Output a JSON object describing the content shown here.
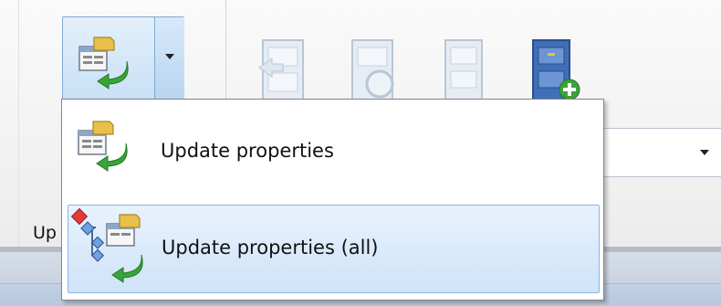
{
  "ribbon": {
    "group_label": "Up",
    "split_button": {
      "icon": "update-properties-icon",
      "arrow_icon": "dropdown-arrow-icon"
    },
    "buttons": [
      {
        "icon": "cabinet-export-icon"
      },
      {
        "icon": "cabinet-search-icon"
      },
      {
        "icon": "cabinet-icon"
      },
      {
        "icon": "cabinet-add-icon"
      }
    ],
    "combo_arrow_icon": "combo-dropdown-icon"
  },
  "menu": {
    "items": [
      {
        "label": "Update properties",
        "icon": "update-properties-icon",
        "highlighted": false
      },
      {
        "label": "Update properties (all)",
        "icon": "update-properties-all-icon",
        "highlighted": true
      }
    ]
  },
  "colors": {
    "highlight": "#cfe3f9",
    "highlight_border": "#8cb4e0",
    "arrow_green": "#3aa33a",
    "folder_yellow": "#e8c04a"
  }
}
